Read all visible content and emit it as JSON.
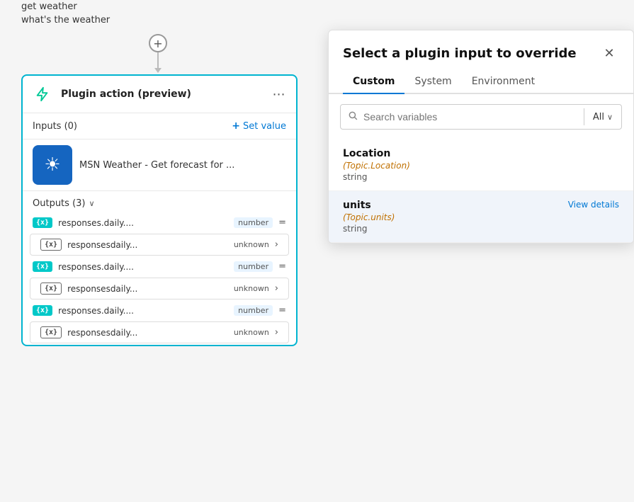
{
  "canvas": {
    "trigger_items": [
      "get weather",
      "what's the weather"
    ],
    "plus_symbol": "+"
  },
  "plugin_card": {
    "title": "Plugin action (preview)",
    "menu_dots": "⋯",
    "inputs_label": "Inputs (0)",
    "set_value_label": "Set value",
    "msn_label": "MSN Weather - Get forecast for ...",
    "msn_icon": "☀",
    "outputs_label": "Outputs (3)",
    "outputs": [
      {
        "type": "teal",
        "badge": "{x}",
        "name": "responses.daily....",
        "tag": "number",
        "suffix": "="
      },
      {
        "type": "light",
        "badge": "{x}",
        "name": "responsesdaily...",
        "tag": "unknown",
        "suffix": "›"
      },
      {
        "type": "teal",
        "badge": "{x}",
        "name": "responses.daily....",
        "tag": "number",
        "suffix": "="
      },
      {
        "type": "light",
        "badge": "{x}",
        "name": "responsesdaily...",
        "tag": "unknown",
        "suffix": "›"
      },
      {
        "type": "teal",
        "badge": "{x}",
        "name": "responses.daily....",
        "tag": "number",
        "suffix": "="
      },
      {
        "type": "light",
        "badge": "{x}",
        "name": "responsesdaily...",
        "tag": "unknown",
        "suffix": "›"
      }
    ]
  },
  "panel": {
    "title": "Select a plugin input to override",
    "close_icon": "✕",
    "tabs": [
      {
        "label": "Custom",
        "active": true
      },
      {
        "label": "System",
        "active": false
      },
      {
        "label": "Environment",
        "active": false
      }
    ],
    "search_placeholder": "Search variables",
    "search_icon": "🔍",
    "all_label": "All",
    "variables": [
      {
        "name": "Location",
        "topic": "(Topic.Location)",
        "type": "string",
        "selected": false,
        "view_details": null
      },
      {
        "name": "units",
        "topic": "(Topic.units)",
        "type": "string",
        "selected": true,
        "view_details": "View details"
      }
    ]
  }
}
